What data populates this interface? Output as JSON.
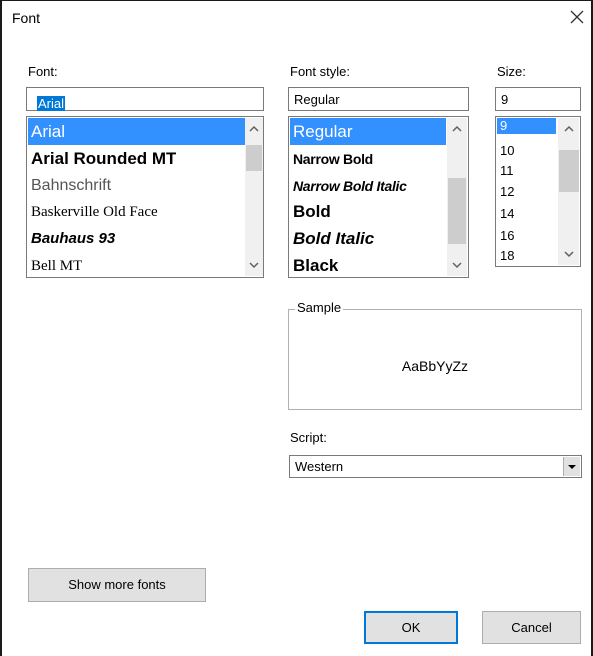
{
  "dialog": {
    "title": "Font"
  },
  "font": {
    "label": "Font:",
    "value": "Arial",
    "items": [
      "Arial",
      "Arial Rounded MT",
      "Bahnschrift",
      "Baskerville Old Face",
      "Bauhaus 93",
      "Bell MT"
    ],
    "selected_index": 0
  },
  "font_style": {
    "label": "Font style:",
    "value": "Regular",
    "items": [
      "Regular",
      "Narrow Bold",
      "Narrow Bold Italic",
      "Bold",
      "Bold Italic",
      "Black"
    ],
    "selected_index": 0
  },
  "size": {
    "label": "Size:",
    "value": "9",
    "items": [
      "9",
      "10",
      "11",
      "12",
      "14",
      "16",
      "18"
    ],
    "selected_index": 0
  },
  "sample": {
    "legend": "Sample",
    "text": "AaBbYyZz"
  },
  "script": {
    "label": "Script:",
    "value": "Western"
  },
  "buttons": {
    "show_more": "Show more fonts",
    "ok": "OK",
    "cancel": "Cancel"
  },
  "colors": {
    "selection": "#3390ff",
    "focus_border": "#0078d7"
  }
}
